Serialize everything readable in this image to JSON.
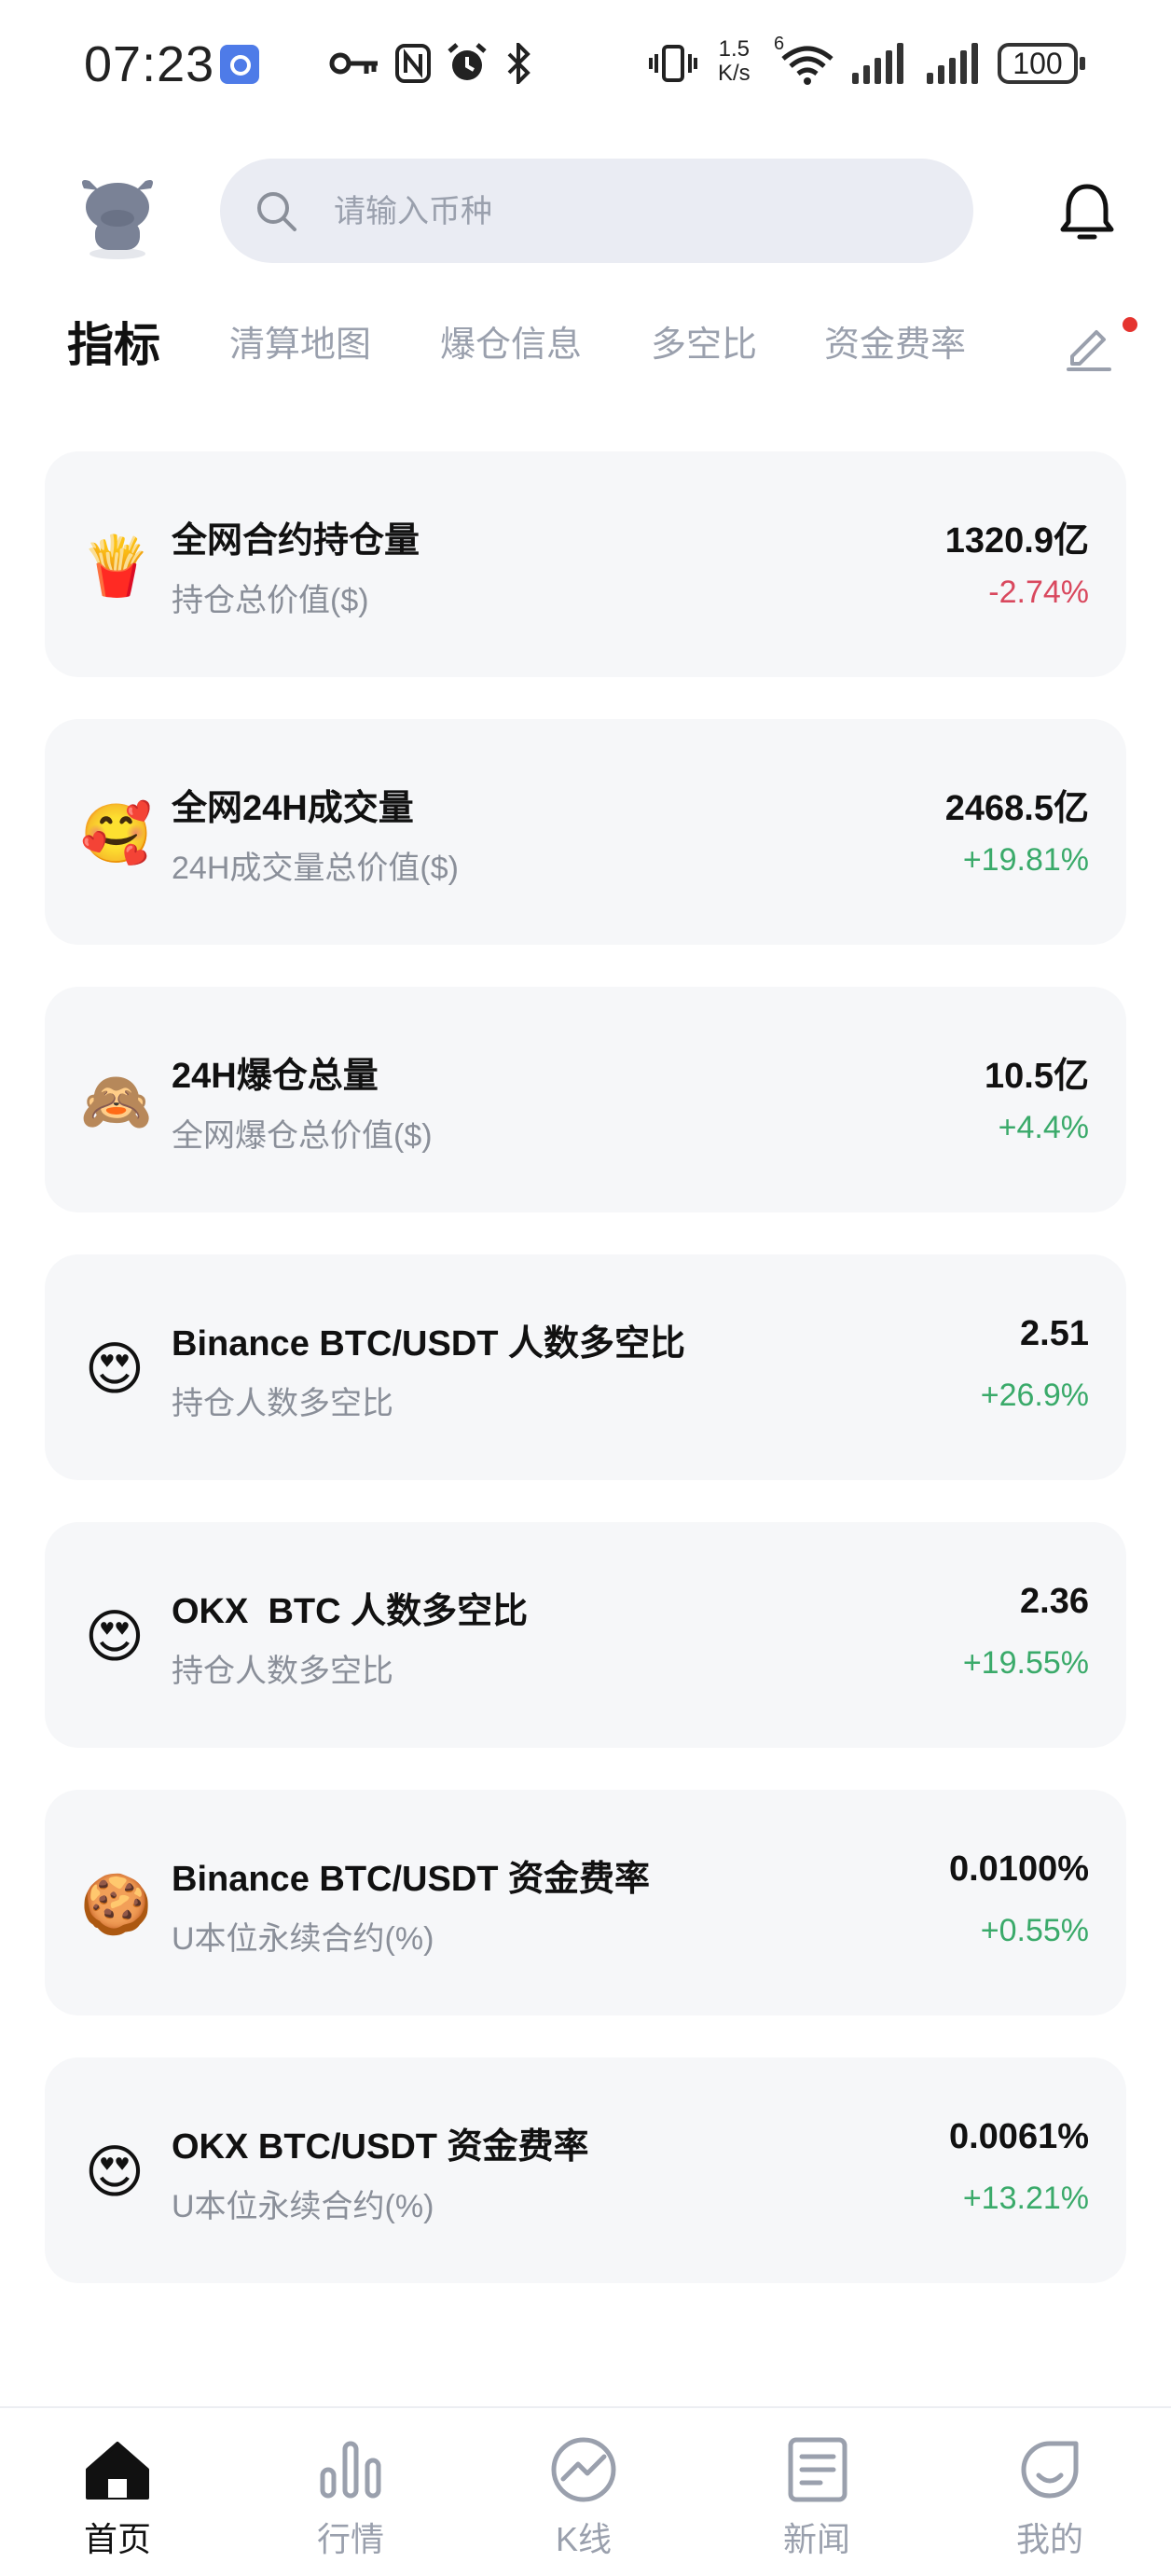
{
  "status_bar": {
    "time": "07:23",
    "net_speed_value": "1.5",
    "net_speed_unit": "K/s",
    "wifi_label": "6",
    "battery": "100",
    "icons": [
      "app-notification-icon",
      "key-icon",
      "nfc-icon",
      "alarm-icon",
      "bluetooth-icon",
      "vibrate-icon",
      "wifi-icon",
      "signal-icon",
      "signal-icon"
    ]
  },
  "header": {
    "search_placeholder": "请输入币种",
    "icons": [
      "avatar-cow-icon",
      "search-icon",
      "bell-icon"
    ]
  },
  "tabs": [
    {
      "label": "指标",
      "active": true
    },
    {
      "label": "清算地图",
      "active": false
    },
    {
      "label": "爆仓信息",
      "active": false
    },
    {
      "label": "多空比",
      "active": false
    },
    {
      "label": "资金费率",
      "active": false
    }
  ],
  "cards": [
    {
      "emoji": "🍟",
      "title": "全网合约持仓量",
      "subtitle": "持仓总价值($)",
      "value": "1320.9亿",
      "change": "-2.74%",
      "direction": "down"
    },
    {
      "emoji": "🥰",
      "title": "全网24H成交量",
      "subtitle": "24H成交量总价值($)",
      "value": "2468.5亿",
      "change": "+19.81%",
      "direction": "up"
    },
    {
      "emoji": "🙈",
      "title": "24H爆仓总量",
      "subtitle": "全网爆仓总价值($)",
      "value": "10.5亿",
      "change": "+4.4%",
      "direction": "up"
    },
    {
      "emoji": "😍",
      "title": "Binance BTC/USDT 人数多空比",
      "subtitle": "持仓人数多空比",
      "value": "2.51",
      "change": "+26.9%",
      "direction": "up"
    },
    {
      "emoji": "😍",
      "title": "OKX  BTC 人数多空比",
      "subtitle": "持仓人数多空比",
      "value": "2.36",
      "change": "+19.55%",
      "direction": "up"
    },
    {
      "emoji": "🍪",
      "title": "Binance BTC/USDT 资金费率",
      "subtitle": "U本位永续合约(%)",
      "value": "0.0100%",
      "change": "+0.55%",
      "direction": "up"
    },
    {
      "emoji": "😍",
      "title": "OKX BTC/USDT 资金费率",
      "subtitle": "U本位永续合约(%)",
      "value": "0.0061%",
      "change": "+13.21%",
      "direction": "up"
    }
  ],
  "bottom_nav": [
    {
      "label": "首页",
      "icon": "home-icon",
      "active": true
    },
    {
      "label": "行情",
      "icon": "bar-chart-icon",
      "active": false
    },
    {
      "label": "K线",
      "icon": "trend-circle-icon",
      "active": false
    },
    {
      "label": "新闻",
      "icon": "news-icon",
      "active": false
    },
    {
      "label": "我的",
      "icon": "profile-icon",
      "active": false
    }
  ],
  "colors": {
    "up": "#3aaa6a",
    "down": "#d9485e",
    "accent_dot": "#e5342f",
    "card_bg": "#f6f7f9"
  }
}
